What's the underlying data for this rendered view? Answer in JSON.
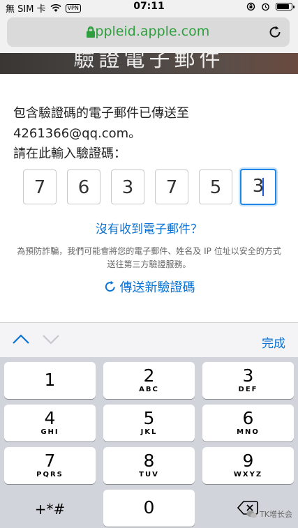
{
  "status_bar": {
    "carrier": "無 SIM 卡",
    "vpn": "VPN",
    "time": "07:11",
    "battery_level": 0.9
  },
  "browser": {
    "url": "appleid.apple.com",
    "accent_color": "#2f9e3e"
  },
  "banner": {
    "title": "驗證電子郵件"
  },
  "page": {
    "message_line1": "包含驗證碼的電子郵件已傳送至",
    "message_line2": "4261366@qq.com。",
    "message_line3": "請在此輸入驗證碼：",
    "code_digits": [
      "7",
      "6",
      "3",
      "7",
      "5",
      "3"
    ],
    "no_email_link": "沒有收到電子郵件？",
    "disclaimer": "為預防詐騙，我們可能會將您的電子郵件、姓名及 IP 位址以安全的方式送往第三方驗證服務。",
    "resend_label": "傳送新驗證碼",
    "link_color": "#0a73d5"
  },
  "accessory": {
    "done_label": "完成"
  },
  "keypad": {
    "keys": [
      {
        "digit": "1",
        "letters": ""
      },
      {
        "digit": "2",
        "letters": "ABC"
      },
      {
        "digit": "3",
        "letters": "DEF"
      },
      {
        "digit": "4",
        "letters": "GHI"
      },
      {
        "digit": "5",
        "letters": "JKL"
      },
      {
        "digit": "6",
        "letters": "MNO"
      },
      {
        "digit": "7",
        "letters": "PQRS"
      },
      {
        "digit": "8",
        "letters": "TUV"
      },
      {
        "digit": "9",
        "letters": "WXYZ"
      },
      {
        "digit": "+*#",
        "letters": ""
      },
      {
        "digit": "0",
        "letters": ""
      },
      {
        "digit": "",
        "letters": ""
      }
    ]
  },
  "watermark": {
    "text": "TK增长会"
  }
}
